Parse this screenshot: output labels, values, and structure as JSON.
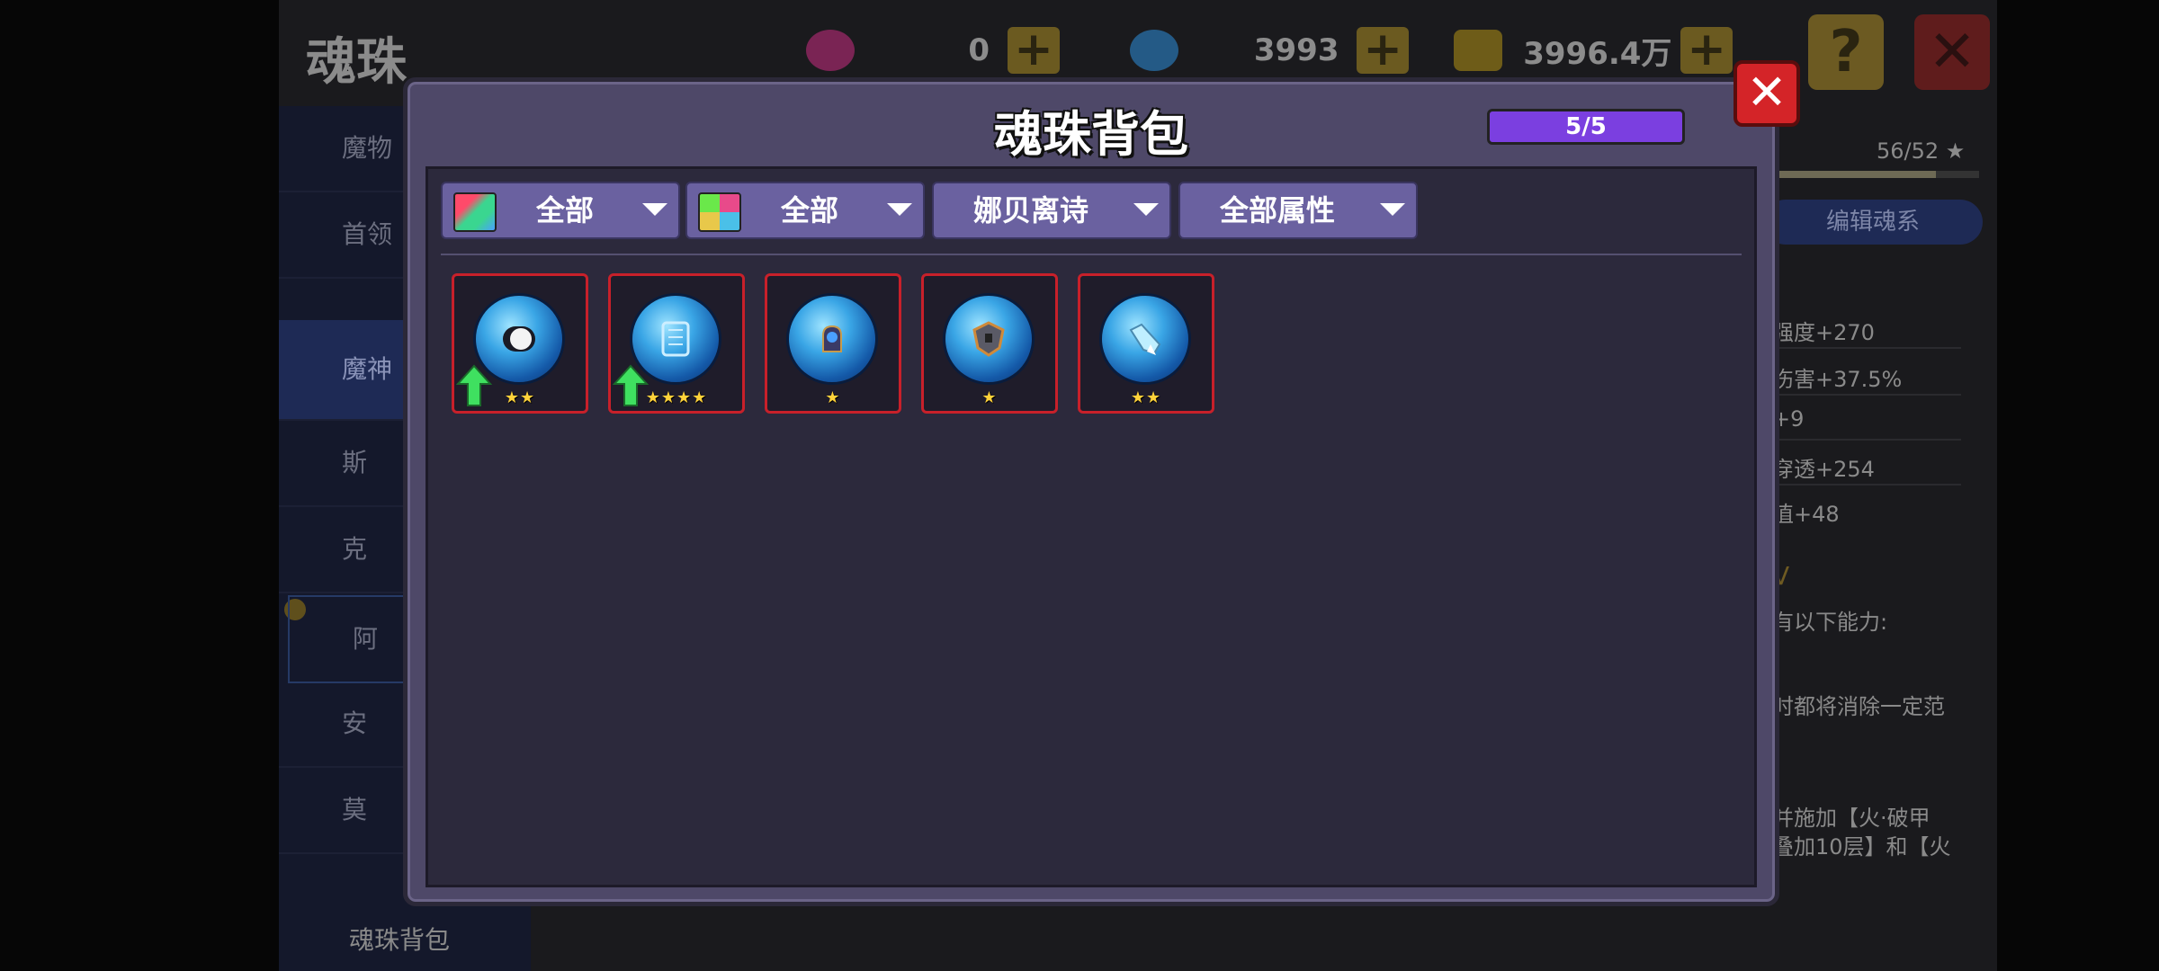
{
  "background": {
    "title": "魂珠",
    "currencies": [
      {
        "icon": "purple-gem-icon",
        "value": "0",
        "color": "#a0306a"
      },
      {
        "icon": "blue-gem-icon",
        "value": "3993",
        "color": "#2e6a9e"
      },
      {
        "icon": "gold-coin-icon",
        "value": "3996.4万",
        "color": "#8a7420"
      }
    ],
    "help_label": "?",
    "close_label": "✕",
    "side_nav": [
      "魔物",
      "首领",
      "魔神",
      "斯",
      "克",
      "阿",
      "安",
      "莫"
    ],
    "bag_label": "魂珠背包",
    "right_panel": {
      "level_text": "56/52 ★",
      "edit_button": "编辑魂系",
      "stats": [
        "强度+270",
        "伤害+37.5%",
        "+9",
        "穿透+254",
        "值+48"
      ],
      "ability_heading": "V",
      "ability_lines": [
        "有以下能力:",
        "时都将消除一定范",
        "并施加【火·破甲",
        "叠加10层】和【火"
      ]
    }
  },
  "modal": {
    "title": "魂珠背包",
    "capacity": "5/5",
    "close_label": "✕",
    "filters": [
      {
        "label": "全部",
        "icon": "rarity-filter-icon"
      },
      {
        "label": "全部",
        "icon": "type-filter-icon"
      },
      {
        "label": "娜贝离诗",
        "icon": ""
      },
      {
        "label": "全部属性",
        "icon": ""
      }
    ],
    "items": [
      {
        "icon": "white-pearl-orb-icon",
        "stars": "★★",
        "upgradable": true
      },
      {
        "icon": "scroll-orb-icon",
        "stars": "★★★★",
        "upgradable": true
      },
      {
        "icon": "gauntlet-orb-icon",
        "stars": "★",
        "upgradable": false
      },
      {
        "icon": "shield-orb-icon",
        "stars": "★",
        "upgradable": false
      },
      {
        "icon": "crystal-shard-orb-icon",
        "stars": "★★",
        "upgradable": false
      }
    ]
  }
}
